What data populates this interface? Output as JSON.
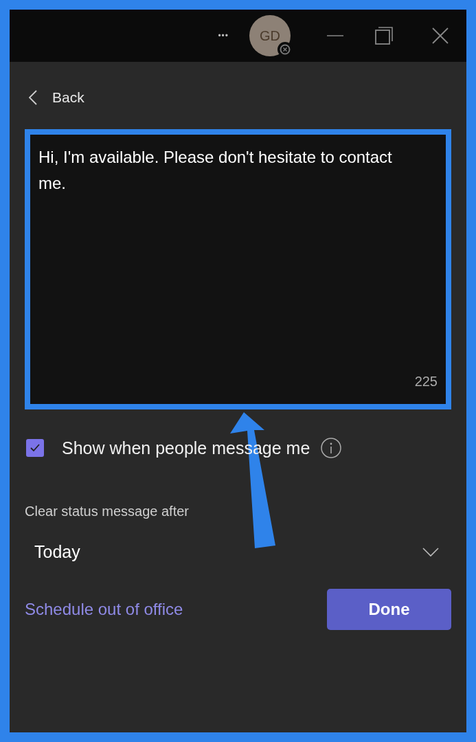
{
  "title_bar": {
    "more": "•••",
    "avatar_initials": "GD"
  },
  "back": {
    "label": "Back"
  },
  "status_message": {
    "value": "Hi, I'm available. Please don't hesitate to contact me.",
    "char_count": "225",
    "highlighted": true
  },
  "show_when_messaged": {
    "label": "Show when people message me",
    "checked": true
  },
  "clear_after": {
    "label": "Clear status message after",
    "value": "Today"
  },
  "schedule_link": "Schedule out of office",
  "done_button": "Done"
}
